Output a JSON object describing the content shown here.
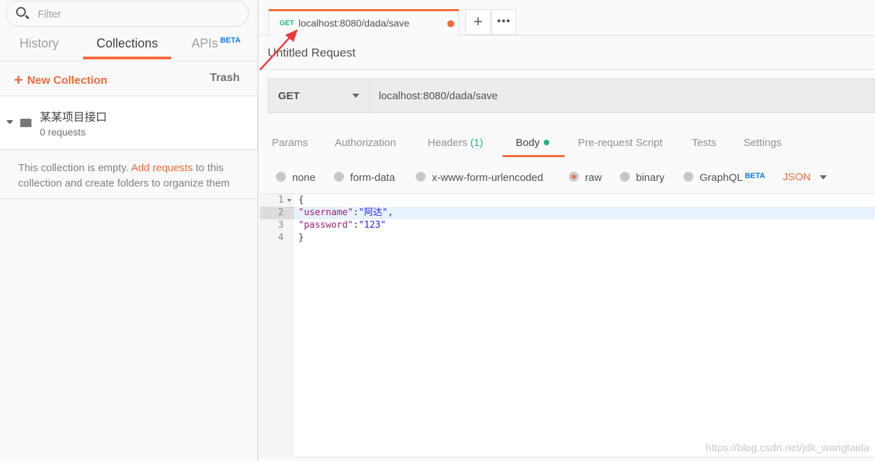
{
  "sidebar": {
    "filter_placeholder": "Filter",
    "tabs": [
      "History",
      "Collections",
      "APIs"
    ],
    "beta": "BETA",
    "new_collection": "New Collection",
    "trash": "Trash",
    "collection": {
      "name": "某某项目接口",
      "count": "0 requests"
    },
    "empty": {
      "pre": "This collection is empty. ",
      "link": "Add requests",
      "post": " to this collection and create folders to organize them"
    }
  },
  "tab": {
    "method": "GET",
    "url": "localhost:8080/dada/save"
  },
  "request": {
    "title": "Untitled Request",
    "method": "GET",
    "url": "localhost:8080/dada/save"
  },
  "param_tabs": {
    "params": "Params",
    "authorization": "Authorization",
    "headers": "Headers",
    "headers_count": "(1)",
    "body": "Body",
    "prerequest": "Pre-request Script",
    "tests": "Tests",
    "settings": "Settings"
  },
  "body_types": {
    "none": "none",
    "formdata": "form-data",
    "urlencoded": "x-www-form-urlencoded",
    "raw": "raw",
    "binary": "binary",
    "graphql": "GraphQL",
    "beta": "BETA",
    "format": "JSON"
  },
  "editor": {
    "lines": [
      {
        "n": "1",
        "brace": "{"
      },
      {
        "n": "2",
        "key": "\"username\"",
        "colon": ":",
        "val": "\"阿达\"",
        "tail": ","
      },
      {
        "n": "3",
        "key": "\"password\"",
        "colon": ":",
        "val": "\"123\""
      },
      {
        "n": "4",
        "brace": "}"
      }
    ]
  },
  "watermark": "https://blog.csdn.net/jdk_wangtaida",
  "colors": {
    "accent": "#f26b3a",
    "get": "#26b47f",
    "beta": "#097bed"
  }
}
